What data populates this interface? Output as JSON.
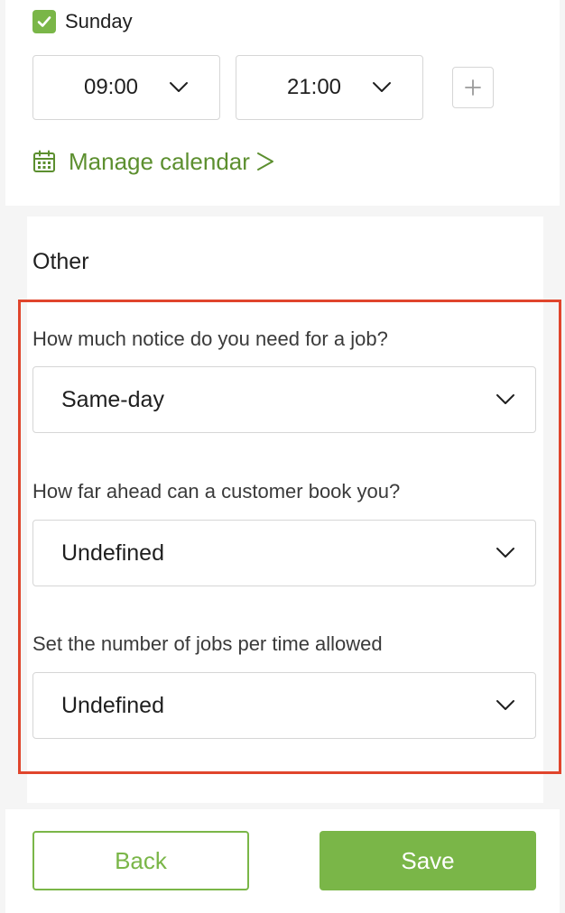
{
  "schedule": {
    "day_label": "Sunday",
    "day_checked": true,
    "start_time": "09:00",
    "end_time": "21:00",
    "add_icon": "plus-icon"
  },
  "manage_calendar": {
    "label": "Manage calendar",
    "icon": "calendar-icon"
  },
  "other": {
    "title": "Other",
    "notice": {
      "question": "How much notice do you need for a job?",
      "value": "Same-day"
    },
    "booking_ahead": {
      "question": "How far ahead can a customer book you?",
      "value": "Undefined"
    },
    "jobs_per_time": {
      "question": "Set the number of jobs per time allowed",
      "value": "Undefined"
    }
  },
  "actions": {
    "back_label": "Back",
    "save_label": "Save"
  },
  "colors": {
    "accent_green": "#7ab648",
    "link_green": "#5c8f2f",
    "highlight_red": "#e0452c"
  }
}
